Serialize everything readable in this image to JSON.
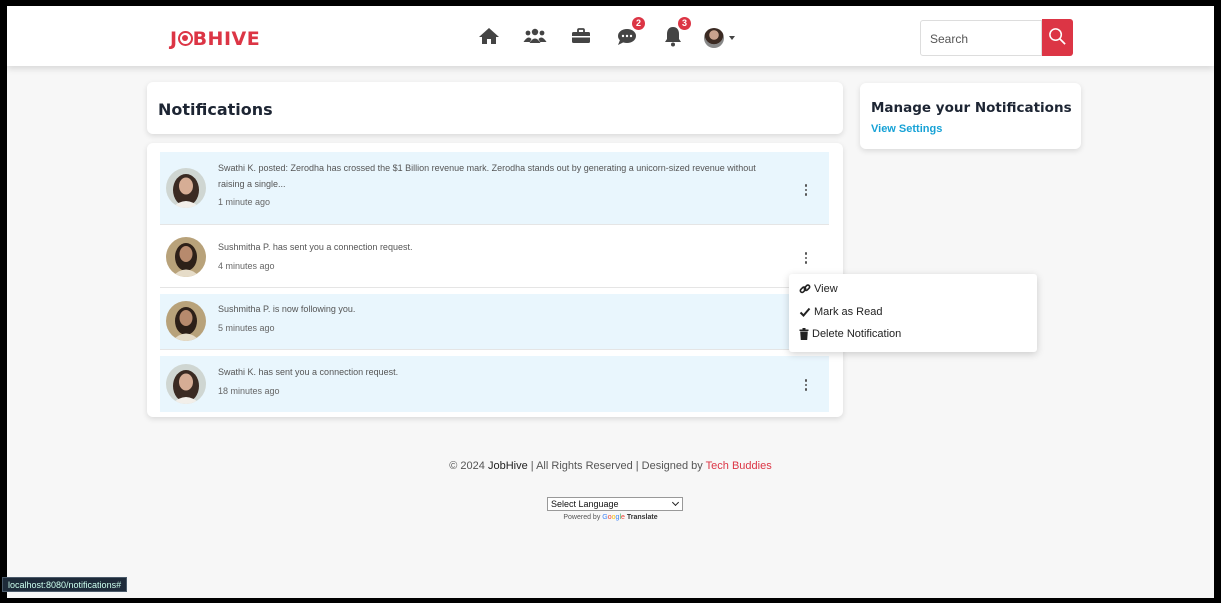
{
  "navbar": {
    "logo": "JOBHIVE",
    "messages_badge": "2",
    "notifications_badge": "3",
    "search_placeholder": "Search"
  },
  "notifications_heading": "Notifications",
  "manage": {
    "title": "Manage your Notifications",
    "link": "View Settings"
  },
  "notifications": [
    {
      "text": "Swathi K. posted: Zerodha has crossed the $1 Billion revenue mark. Zerodha stands out by generating a unicorn-sized revenue without raising a single...",
      "time": "1 minute ago"
    },
    {
      "text": "Sushmitha P. has sent you a connection request.",
      "time": "4 minutes ago"
    },
    {
      "text": "Sushmitha P. is now following you.",
      "time": "5 minutes ago"
    },
    {
      "text": "Swathi K. has sent you a connection request.",
      "time": "18 minutes ago"
    }
  ],
  "dropdown": {
    "view": "View",
    "mark_read": "Mark as Read",
    "delete": "Delete Notification"
  },
  "footer": {
    "copyright": "© 2024",
    "brand": "JobHive",
    "rights": "| All Rights Reserved | Designed by",
    "designer": "Tech Buddies",
    "language_select": "Select Language",
    "powered_by": "Powered by",
    "google": "Google",
    "translate": "Translate"
  },
  "status_url": "localhost:8080/notifications#",
  "colors": {
    "brand_red": "#dc3545",
    "link_blue": "#17a2d6",
    "unread_bg": "#e9f6fd"
  }
}
